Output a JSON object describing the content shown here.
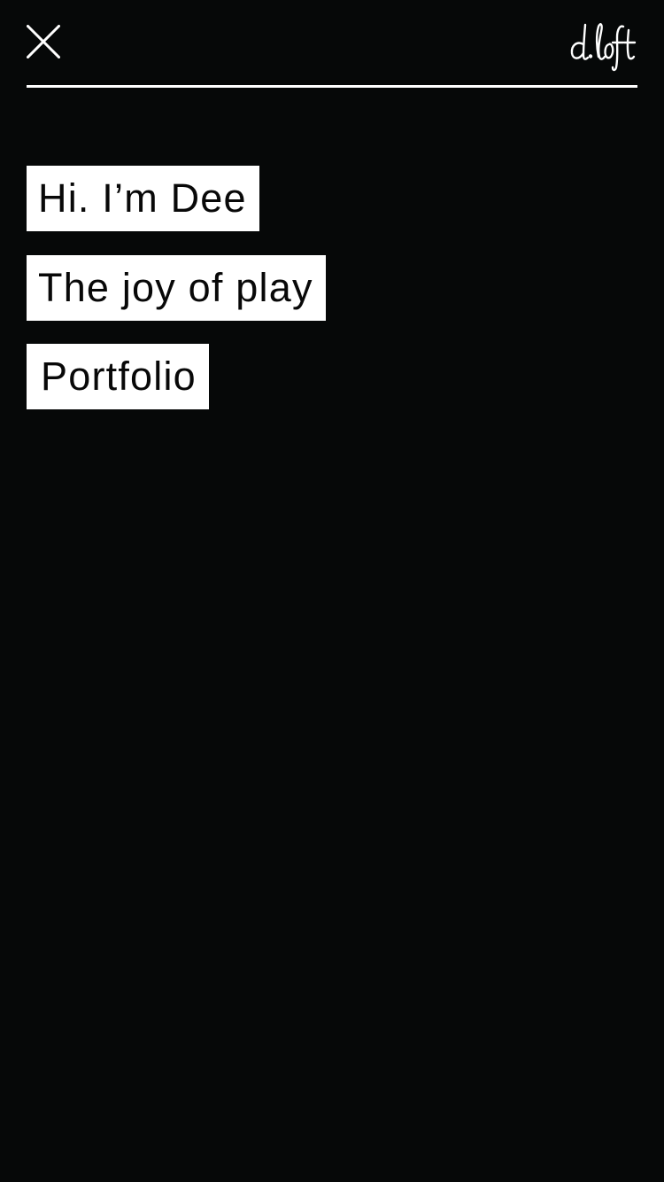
{
  "header": {
    "close_icon": "close-icon",
    "logo_text": "d.loft"
  },
  "menu": {
    "items": [
      {
        "label": "Hi. I’m Dee"
      },
      {
        "label": "The joy of play"
      },
      {
        "label": "Portfolio"
      }
    ]
  },
  "colors": {
    "background": "#060808",
    "foreground": "#ffffff",
    "menu_text": "#080808"
  }
}
